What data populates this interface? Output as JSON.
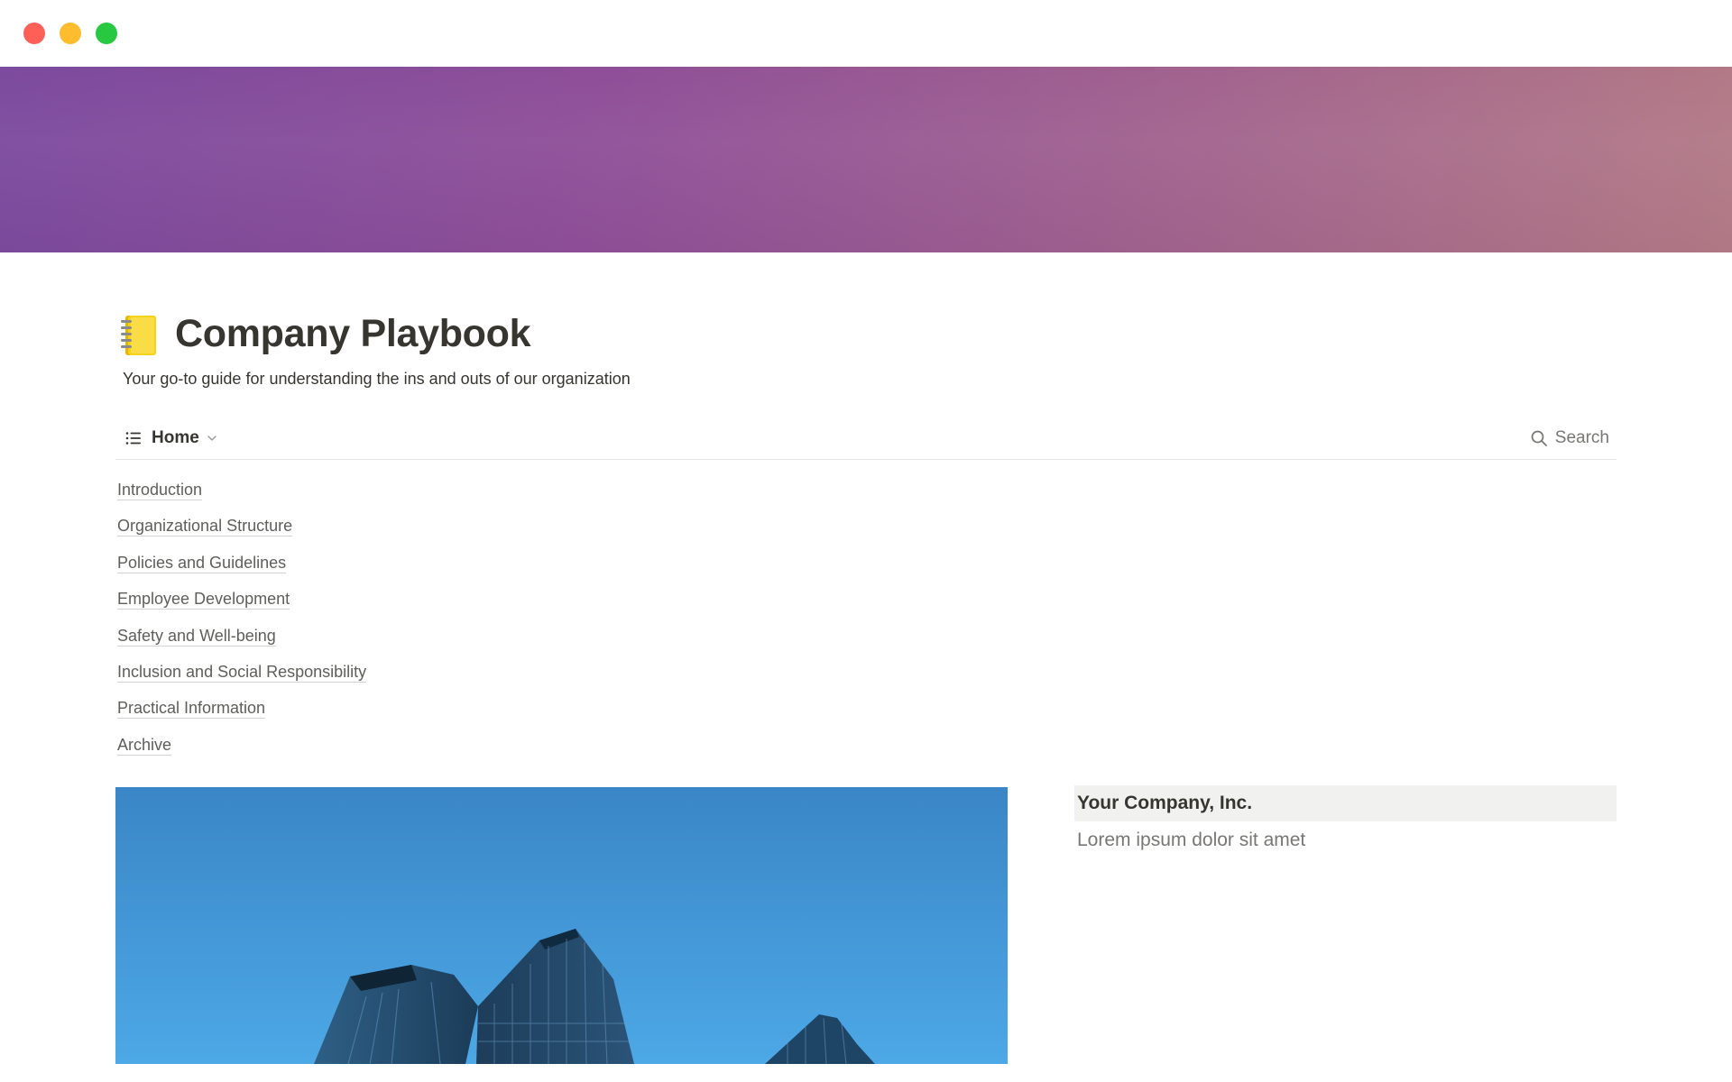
{
  "window": {
    "controls": [
      "close",
      "minimize",
      "zoom"
    ]
  },
  "page": {
    "icon": "notebook-icon",
    "title": "Company Playbook",
    "subtitle": "Your go-to guide for understanding the ins and outs of our organization"
  },
  "view": {
    "active_view": "Home",
    "view_icon": "list-icon",
    "search_label": "Search"
  },
  "links": [
    "Introduction",
    "Organizational Structure",
    "Policies and Guidelines",
    "Employee Development",
    "Safety and Well-being",
    "Inclusion and Social Responsibility",
    "Practical Information",
    "Archive"
  ],
  "company": {
    "name": "Your Company, Inc.",
    "description": "Lorem ipsum dolor sit amet"
  },
  "colors": {
    "cover_gradient_start": "#7c4a9e",
    "cover_gradient_end": "#b37a86",
    "sky": "#3d8ccc",
    "text": "#37352f",
    "muted_text": "#787774"
  }
}
